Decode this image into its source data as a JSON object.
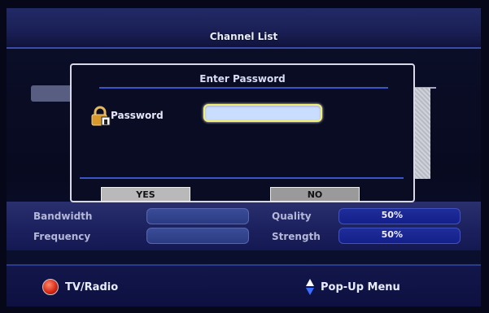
{
  "header": {
    "title": "Channel List"
  },
  "dialog": {
    "title": "Enter Password",
    "password_label": "Password",
    "password_value": "",
    "yes_label": "YES",
    "no_label": "NO"
  },
  "info": {
    "bandwidth_label": "Bandwidth",
    "frequency_label": "Frequency",
    "quality_label": "Quality",
    "quality_value": "50%",
    "strength_label": "Strength",
    "strength_value": "50%"
  },
  "footer": {
    "tv_radio_label": "TV/Radio",
    "popup_menu_label": "Pop-Up Menu"
  },
  "icons": {
    "tv_radio": "red-button-icon",
    "popup_menu": "up-down-arrow-icon",
    "lock": "lock-icon"
  },
  "colors": {
    "background": "#0c0f2a",
    "accent": "#3a55c8",
    "input_fill": "#c8ddff",
    "input_focus_border": "#f2f070",
    "tv_radio_button": "#d92a1a"
  }
}
